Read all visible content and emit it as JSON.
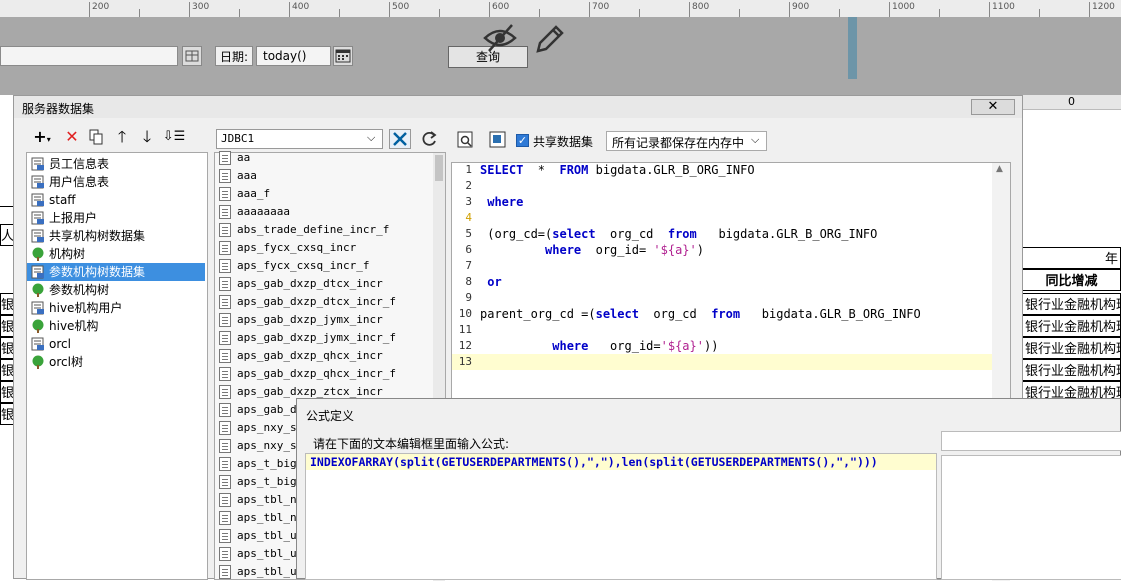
{
  "ruler": {
    "labels": [
      "200",
      "300",
      "400",
      "500",
      "600",
      "700",
      "800",
      "900",
      "1000",
      "1100",
      "1200"
    ]
  },
  "toolbar": {
    "date_label": "日期:",
    "date_value": "today()",
    "query_button": "查询"
  },
  "sheet": {
    "col_zero": "0",
    "header_year": "年",
    "header_yoy": "同比增减",
    "row_left_char": "银",
    "row_right_text": "银行业金融机构理",
    "left_char_a": "人"
  },
  "dataset_dialog": {
    "title": "服务器数据集",
    "tree_items": [
      {
        "label": "员工信息表",
        "icon": "table-icon"
      },
      {
        "label": "用户信息表",
        "icon": "table-icon"
      },
      {
        "label": "staff",
        "icon": "table-icon"
      },
      {
        "label": "上报用户",
        "icon": "table-icon"
      },
      {
        "label": "共享机构树数据集",
        "icon": "table-icon"
      },
      {
        "label": "机构树",
        "icon": "tree-icon"
      },
      {
        "label": "参数机构树数据集",
        "icon": "table-icon"
      },
      {
        "label": "参数机构树",
        "icon": "tree-icon"
      },
      {
        "label": "hive机构用户",
        "icon": "table-icon"
      },
      {
        "label": "hive机构",
        "icon": "tree-icon"
      },
      {
        "label": "orcl",
        "icon": "table-icon"
      },
      {
        "label": "orcl树",
        "icon": "tree-icon"
      }
    ],
    "selected_index": 6,
    "connection": "JDBC1",
    "tables": [
      "aa",
      "aaa",
      "aaa_f",
      "aaaaaaaa",
      "abs_trade_define_incr_f",
      "aps_fycx_cxsq_incr",
      "aps_fycx_cxsq_incr_f",
      "aps_gab_dxzp_dtcx_incr",
      "aps_gab_dxzp_dtcx_incr_f",
      "aps_gab_dxzp_jymx_incr",
      "aps_gab_dxzp_jymx_incr_f",
      "aps_gab_dxzp_qhcx_incr",
      "aps_gab_dxzp_qhcx_incr_f",
      "aps_gab_dxzp_ztcx_incr",
      "aps_gab_dx",
      "aps_nxy_sr",
      "aps_nxy_sr",
      "aps_t_bigd",
      "aps_t_bigd",
      "aps_tbl_nx",
      "aps_tbl_nx",
      "aps_tbl_up",
      "aps_tbl_up",
      "aps_tbl_up"
    ],
    "share_checkbox_label": "共享数据集",
    "cache_select": "所有记录都保存在内存中",
    "sql_lines": [
      {
        "n": "1",
        "t": "SELECT  *  FROM bigdata.GLR_B_ORG_INFO"
      },
      {
        "n": "2",
        "t": ""
      },
      {
        "n": "3",
        "t": " where"
      },
      {
        "n": "4",
        "t": ""
      },
      {
        "n": "5",
        "t": " (org_cd=(select  org_cd  from   bigdata.GLR_B_ORG_INFO"
      },
      {
        "n": "6",
        "t": "         where  org_id= '${a}')"
      },
      {
        "n": "7",
        "t": ""
      },
      {
        "n": "8",
        "t": " or"
      },
      {
        "n": "9",
        "t": ""
      },
      {
        "n": "10",
        "t": "parent_org_cd =(select  org_cd  from   bigdata.GLR_B_ORG_INFO"
      },
      {
        "n": "11",
        "t": ""
      },
      {
        "n": "12",
        "t": "          where   org_id='${a}'))"
      },
      {
        "n": "13",
        "t": ""
      }
    ]
  },
  "formula_dialog": {
    "title": "公式定义",
    "prompt": "请在下面的文本编辑框里面输入公式:",
    "formula": "INDEXOFARRAY(split(GETUSERDEPARTMENTS(),\",\"),len(split(GETUSERDEPARTMENTS(),\",\")))"
  }
}
